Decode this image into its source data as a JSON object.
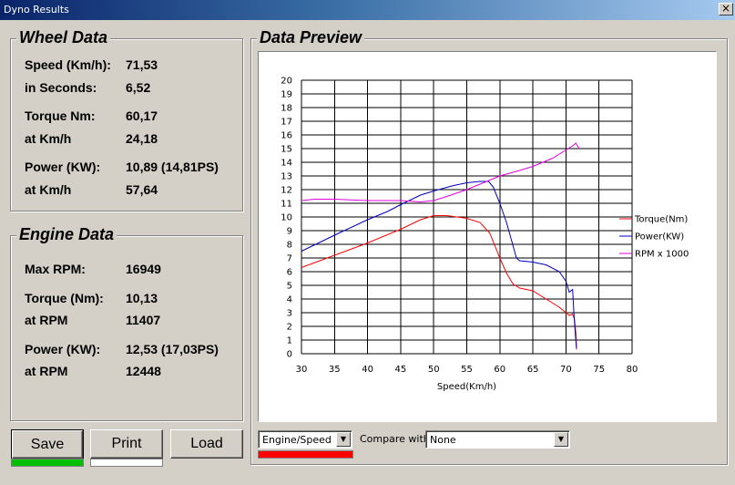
{
  "window": {
    "title": "Dyno Results",
    "close_glyph": "×"
  },
  "wheel": {
    "title": "Wheel Data",
    "rows": [
      {
        "label": "Speed (Km/h):",
        "value": "71,53"
      },
      {
        "label": "in Seconds:",
        "value": "6,52"
      },
      {
        "label": "Torque Nm:",
        "value": "60,17"
      },
      {
        "label": "at Km/h",
        "value": "24,18"
      },
      {
        "label": "Power (KW):",
        "value": "10,89 (14,81PS)"
      },
      {
        "label": "at Km/h",
        "value": "57,64"
      }
    ]
  },
  "engine": {
    "title": "Engine Data",
    "rows": [
      {
        "label": "Max RPM:",
        "value": "16949"
      },
      {
        "label": "Torque (Nm):",
        "value": "10,13"
      },
      {
        "label": "at RPM",
        "value": "11407"
      },
      {
        "label": "Power (KW):",
        "value": "12,53 (17,03PS)"
      },
      {
        "label": "at RPM",
        "value": "12448"
      }
    ]
  },
  "buttons": {
    "save": "Save",
    "print": "Print",
    "load": "Load",
    "save_indicator_color": "#00c000",
    "print_indicator_color": "#ffffff"
  },
  "preview": {
    "title": "Data Preview",
    "mode_select": "Engine/Speed",
    "mode_indicator_color": "#ff0000",
    "compare_label": "Compare with",
    "compare_select": "None"
  },
  "chart_data": {
    "type": "line",
    "xlabel": "Speed(Km/h)",
    "ylabel": "",
    "xlim": [
      30,
      80
    ],
    "ylim": [
      0,
      20
    ],
    "xticks": [
      30,
      35,
      40,
      45,
      50,
      55,
      60,
      65,
      70,
      75,
      80
    ],
    "yticks": [
      0,
      1,
      2,
      3,
      4,
      5,
      6,
      7,
      8,
      9,
      10,
      11,
      12,
      13,
      14,
      15,
      16,
      17,
      18,
      19,
      20
    ],
    "grid": true,
    "legend_position": "right",
    "series": [
      {
        "name": "Torque(Nm)",
        "color": "#ff0000",
        "x": [
          30,
          35,
          40,
          45,
          48,
          50,
          52,
          55,
          57,
          58.5,
          60,
          61,
          62,
          63,
          65,
          67,
          69,
          70,
          70.5,
          71,
          71.3,
          71.5,
          71.6
        ],
        "y": [
          6.3,
          7.2,
          8.1,
          9.1,
          9.8,
          10.1,
          10.1,
          9.9,
          9.6,
          8.8,
          7.0,
          5.9,
          5.1,
          4.8,
          4.6,
          4.0,
          3.4,
          3.0,
          2.8,
          2.9,
          2.5,
          1.5,
          0.3
        ]
      },
      {
        "name": "Power(KW)",
        "color": "#0000c0",
        "x": [
          30,
          33,
          36,
          40,
          43,
          45,
          48,
          50,
          53,
          55,
          57,
          58.3,
          59,
          60,
          61,
          62,
          62.5,
          63,
          65,
          67,
          69,
          70,
          70.5,
          71,
          71.2,
          71.4,
          71.6
        ],
        "y": [
          7.5,
          8.2,
          8.9,
          9.8,
          10.4,
          10.9,
          11.6,
          11.9,
          12.3,
          12.5,
          12.6,
          12.6,
          12.2,
          11.0,
          9.6,
          7.9,
          7.0,
          6.8,
          6.7,
          6.5,
          6.0,
          5.3,
          4.5,
          4.7,
          3.0,
          1.5,
          0.4
        ]
      },
      {
        "name": "RPM x 1000",
        "color": "#e000e0",
        "x": [
          30,
          32,
          35,
          40,
          45,
          48,
          50,
          52,
          55,
          58,
          60,
          63,
          65,
          68,
          70,
          71,
          71.5,
          72
        ],
        "y": [
          11.2,
          11.3,
          11.3,
          11.2,
          11.2,
          11.1,
          11.2,
          11.5,
          12.0,
          12.6,
          13.0,
          13.4,
          13.7,
          14.3,
          14.9,
          15.2,
          15.4,
          15.0
        ]
      }
    ]
  }
}
